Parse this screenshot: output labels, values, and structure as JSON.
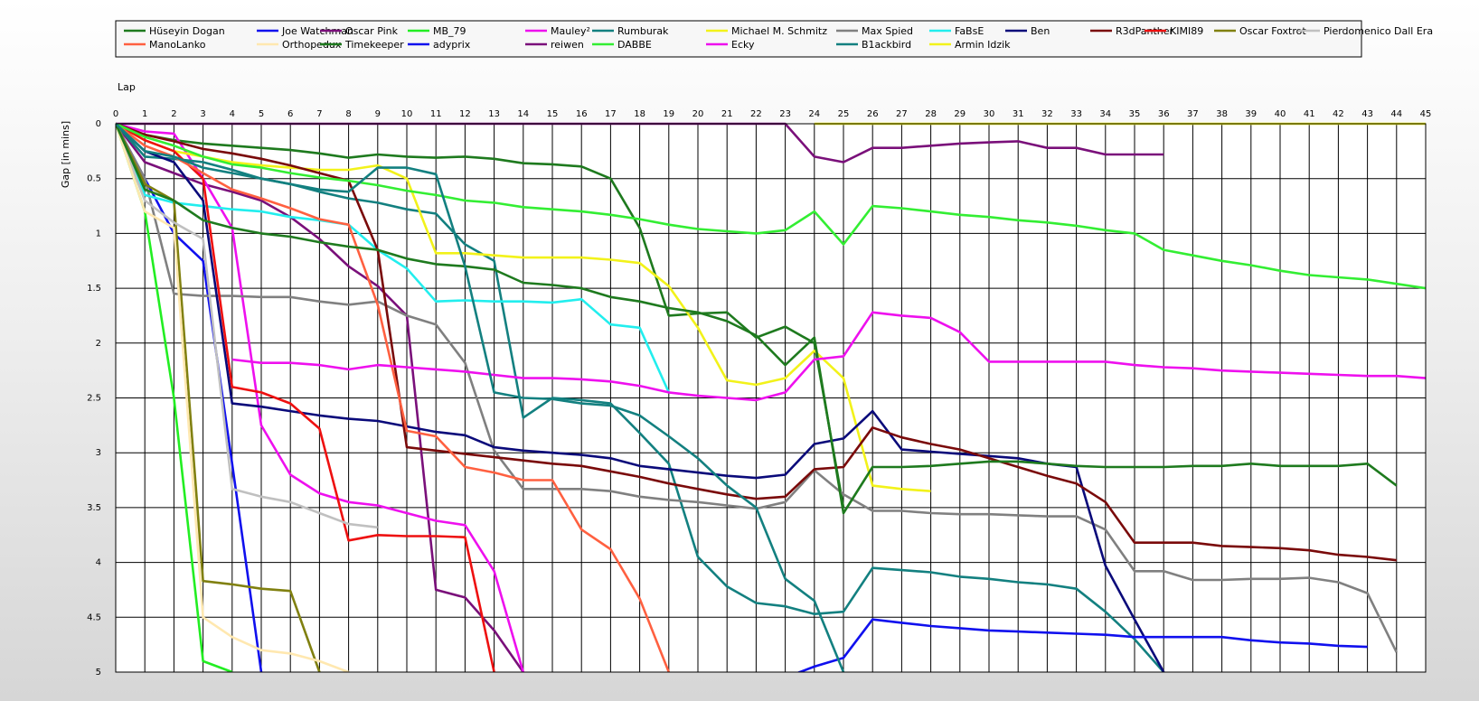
{
  "chart_data": {
    "type": "line",
    "xlabel": "Lap",
    "ylabel": "Gap [in mins]",
    "xlim": [
      0,
      45
    ],
    "ylim": [
      0,
      5
    ],
    "y_inverted": true,
    "grid": true,
    "legend_placement": "top",
    "x_ticks": [
      0,
      1,
      2,
      3,
      4,
      5,
      6,
      7,
      8,
      9,
      10,
      11,
      12,
      13,
      14,
      15,
      16,
      17,
      18,
      19,
      20,
      21,
      22,
      23,
      24,
      25,
      26,
      27,
      28,
      29,
      30,
      31,
      32,
      33,
      34,
      35,
      36,
      37,
      38,
      39,
      40,
      41,
      42,
      43,
      44,
      45
    ],
    "y_ticks": [
      {
        "value": 0,
        "label": "0"
      },
      {
        "value": 0.5,
        "label": "0.5"
      },
      {
        "value": 1,
        "label": "1"
      },
      {
        "value": 1.5,
        "label": "1.5"
      },
      {
        "value": 2,
        "label": "2"
      },
      {
        "value": 2.5,
        "label": "2.5"
      },
      {
        "value": 3,
        "label": "3"
      },
      {
        "value": 3.5,
        "label": "3.5"
      },
      {
        "value": 4,
        "label": "4"
      },
      {
        "value": 4.5,
        "label": "4.5"
      },
      {
        "value": 5,
        "label": "5"
      }
    ],
    "series": [
      {
        "name": "Hüseyin  Dogan",
        "color": "#1e7a1e",
        "values": [
          0,
          0.1,
          0.15,
          0.18,
          0.2,
          0.22,
          0.24,
          0.27,
          0.31,
          0.28,
          0.3,
          0.31,
          0.3,
          0.32,
          0.36,
          0.37,
          0.39,
          0.5,
          0.95,
          1.75,
          1.73,
          1.72,
          1.95,
          1.85,
          2.0,
          3.5
        ]
      },
      {
        "name": "Joe Watchman",
        "color": "#1010ee",
        "values": [
          0,
          0.5,
          1.0,
          1.25,
          3.1,
          5.0
        ]
      },
      {
        "name": "Oscar Pink",
        "color": "#7a107a",
        "values": [
          0,
          0.35,
          0.45,
          0.55,
          0.62,
          0.7,
          0.85,
          1.05,
          1.3,
          1.48,
          1.75,
          4.25,
          4.32,
          4.62,
          5.0
        ]
      },
      {
        "name": "MB_79",
        "color": "#22ee22",
        "values": [
          0,
          0.8,
          2.5,
          4.9,
          5.0
        ]
      },
      {
        "name": "Mauley²",
        "color": "#ee10ee",
        "values": [
          0,
          0.07,
          0.09,
          0.5,
          0.95,
          2.75,
          3.2,
          3.37,
          3.45,
          3.48,
          3.55,
          3.62,
          3.66,
          4.08,
          5.0
        ]
      },
      {
        "name": "Rumburak",
        "color": "#138080",
        "values": [
          0,
          0.3,
          0.32,
          0.35,
          0.42,
          0.5,
          0.55,
          0.62,
          0.68,
          0.72,
          0.78,
          0.82,
          1.1,
          1.25,
          2.68,
          2.5,
          2.52,
          2.55,
          2.82,
          3.1,
          3.95,
          4.22,
          4.37,
          4.4,
          4.47,
          4.45,
          4.05,
          4.07,
          4.09,
          4.13,
          4.15,
          4.18,
          4.2,
          4.24,
          4.45,
          4.7,
          5.0
        ]
      },
      {
        "name": "Michael M. Schmitz",
        "color": "#f2f21a",
        "values": [
          0,
          0.15,
          0.25,
          0.3,
          0.35,
          0.38,
          0.4,
          0.42,
          0.42,
          0.38,
          0.5,
          1.18,
          1.18,
          1.2,
          1.22,
          1.22,
          1.22,
          1.24,
          1.27,
          1.48,
          1.86,
          2.34,
          2.38,
          2.32,
          2.07,
          2.32,
          3.3,
          3.33,
          3.35
        ]
      },
      {
        "name": "Max Spied",
        "color": "#808080",
        "values": [
          0,
          0.5,
          1.55,
          1.57,
          1.57,
          1.58,
          1.58,
          1.62,
          1.65,
          1.62,
          1.75,
          1.83,
          2.18,
          2.98,
          3.33,
          3.33,
          3.33,
          3.35,
          3.4,
          3.43,
          3.45,
          3.48,
          3.51,
          3.45,
          3.16,
          3.38,
          3.53,
          3.53,
          3.55,
          3.56,
          3.56,
          3.57,
          3.58,
          3.58,
          3.7,
          4.08,
          4.08,
          4.16,
          4.16,
          4.15,
          4.15,
          4.14,
          4.18,
          4.28,
          4.82
        ]
      },
      {
        "name": "FaBsE",
        "color": "#22eeee",
        "values": [
          0,
          0.65,
          0.72,
          0.75,
          0.78,
          0.8,
          0.85,
          0.88,
          0.92,
          1.15,
          1.32,
          1.62,
          1.61,
          1.62,
          1.62,
          1.63,
          1.6,
          1.83,
          1.86,
          2.45
        ]
      },
      {
        "name": "Ben",
        "color": "#0a0a7a",
        "values": [
          0,
          0.25,
          0.35,
          0.7,
          2.55,
          2.58,
          2.62,
          2.66,
          2.69,
          2.71,
          2.76,
          2.81,
          2.84,
          2.95,
          2.98,
          3.0,
          3.02,
          3.05,
          3.12,
          3.15,
          3.18,
          3.21,
          3.23,
          3.2,
          2.92,
          2.87,
          2.62,
          2.97,
          2.99,
          3.01,
          3.03,
          3.05,
          3.1,
          3.13,
          4.03,
          4.52,
          5.0
        ]
      },
      {
        "name": "R3dPanther",
        "color": "#7a0a0a",
        "values": [
          0,
          0.1,
          0.16,
          0.23,
          0.27,
          0.32,
          0.38,
          0.45,
          0.52,
          1.15,
          2.95,
          2.98,
          3.01,
          3.04,
          3.07,
          3.1,
          3.12,
          3.17,
          3.22,
          3.28,
          3.33,
          3.38,
          3.42,
          3.4,
          3.15,
          3.13,
          2.77,
          2.86,
          2.92,
          2.97,
          3.05,
          3.13,
          3.21,
          3.28,
          3.45,
          3.82,
          3.82,
          3.82,
          3.85,
          3.86,
          3.87,
          3.89,
          3.93,
          3.95,
          3.98
        ]
      },
      {
        "name": "KIMI89",
        "color": "#ee1010",
        "values": [
          0,
          0.15,
          0.25,
          0.5,
          2.4,
          2.45,
          2.55,
          2.78,
          3.8,
          3.75,
          3.76,
          3.76,
          3.77,
          5.0
        ]
      },
      {
        "name": "Oscar Foxtrot",
        "color": "#808010",
        "values": [
          0,
          0.55,
          0.7,
          4.17,
          4.2,
          4.24,
          4.26,
          5.0
        ]
      },
      {
        "name": "Pierdomenico Dall Era",
        "color": "#c0c0c0",
        "values": [
          0,
          0.7,
          0.9,
          1.05,
          3.33,
          3.4,
          3.45,
          3.55,
          3.65,
          3.68
        ]
      },
      {
        "name": "ManoLanko",
        "color": "#ff6040",
        "values": [
          0,
          0.2,
          0.3,
          0.45,
          0.6,
          0.68,
          0.77,
          0.87,
          0.92,
          1.65,
          2.8,
          2.85,
          3.13,
          3.18,
          3.25,
          3.25,
          3.7,
          3.88,
          4.33,
          5.0
        ]
      },
      {
        "name": "Orthopedux",
        "color": "#ffe8b0",
        "values": [
          0,
          0.8,
          0.95,
          4.5,
          4.68,
          4.8,
          4.83,
          4.9,
          5.0
        ]
      },
      {
        "name": "Timekeeper",
        "color": "#1e7a1e",
        "values": [
          0,
          0.6,
          0.7,
          0.88,
          0.95,
          1.0,
          1.03,
          1.08,
          1.12,
          1.15,
          1.23,
          1.28,
          1.3,
          1.33,
          1.45,
          1.47,
          1.5,
          1.58,
          1.62,
          1.68,
          1.72,
          1.8,
          1.93,
          2.2,
          1.95,
          3.55,
          3.13,
          3.13,
          3.12,
          3.1,
          3.08,
          3.08,
          3.1,
          3.12,
          3.13,
          3.13,
          3.13,
          3.12,
          3.12,
          3.1,
          3.12,
          3.12,
          3.12,
          3.1,
          3.3
        ]
      },
      {
        "name": "adyprix",
        "color": "#1010ee",
        "values": [
          null,
          null,
          null,
          null,
          null,
          null,
          null,
          null,
          null,
          null,
          null,
          null,
          null,
          null,
          null,
          null,
          null,
          null,
          null,
          null,
          null,
          null,
          null,
          5.05,
          4.95,
          4.87,
          4.52,
          4.55,
          4.58,
          4.6,
          4.62,
          4.63,
          4.64,
          4.65,
          4.66,
          4.68,
          4.68,
          4.68,
          4.68,
          4.71,
          4.73,
          4.74,
          4.76,
          4.77
        ]
      },
      {
        "name": "reiwen",
        "color": "#7a107a",
        "values": [
          0,
          0,
          0,
          0,
          0,
          0,
          0,
          0,
          0,
          0,
          0,
          0,
          0,
          0,
          0,
          0,
          0,
          0,
          0,
          0,
          0,
          0,
          0,
          0,
          0.3,
          0.35,
          0.22,
          0.22,
          0.2,
          0.18,
          0.17,
          0.16,
          0.22,
          0.22,
          0.28,
          0.28,
          0.28
        ]
      },
      {
        "name": "DABBE",
        "color": "#33ee33",
        "values": [
          0,
          0.12,
          0.2,
          0.3,
          0.37,
          0.4,
          0.45,
          0.49,
          0.52,
          0.56,
          0.61,
          0.65,
          0.7,
          0.72,
          0.76,
          0.78,
          0.8,
          0.83,
          0.87,
          0.92,
          0.96,
          0.98,
          1.0,
          0.97,
          0.8,
          1.1,
          0.75,
          0.77,
          0.8,
          0.83,
          0.85,
          0.88,
          0.9,
          0.93,
          0.97,
          1.0,
          1.15,
          1.2,
          1.25,
          1.29,
          1.34,
          1.38,
          1.4,
          1.42,
          1.46,
          1.5
        ]
      },
      {
        "name": "Ecky",
        "color": "#ee10ee",
        "values": [
          null,
          null,
          null,
          null,
          2.15,
          2.18,
          2.18,
          2.2,
          2.24,
          2.2,
          2.22,
          2.24,
          2.26,
          2.29,
          2.32,
          2.32,
          2.33,
          2.35,
          2.39,
          2.45,
          2.48,
          2.5,
          2.52,
          2.45,
          2.15,
          2.12,
          1.72,
          1.75,
          1.77,
          1.9,
          2.17,
          2.17,
          2.17,
          2.17,
          2.17,
          2.2,
          2.22,
          2.23,
          2.25,
          2.26,
          2.27,
          2.28,
          2.29,
          2.3,
          2.3,
          2.32
        ]
      },
      {
        "name": "B1ackbird",
        "color": "#138080",
        "values": [
          0,
          0.25,
          0.3,
          0.4,
          0.45,
          0.5,
          0.55,
          0.6,
          0.62,
          0.4,
          0.4,
          0.46,
          1.3,
          2.45,
          2.5,
          2.51,
          2.55,
          2.57,
          2.66,
          2.85,
          3.05,
          3.3,
          3.5,
          4.15,
          4.35,
          5.0
        ]
      },
      {
        "name": "Armin Idzik",
        "color": "#f2f21a",
        "values": [
          null,
          null,
          null,
          null,
          null,
          null,
          null,
          null,
          null,
          null,
          null,
          null,
          null,
          null,
          null,
          null,
          null,
          null,
          null,
          null,
          null,
          null,
          null,
          null,
          0,
          0,
          0,
          0,
          0,
          0,
          0,
          0,
          0,
          0,
          0,
          0,
          0,
          0,
          0,
          0,
          0,
          0,
          0,
          0,
          0,
          0
        ]
      }
    ]
  }
}
